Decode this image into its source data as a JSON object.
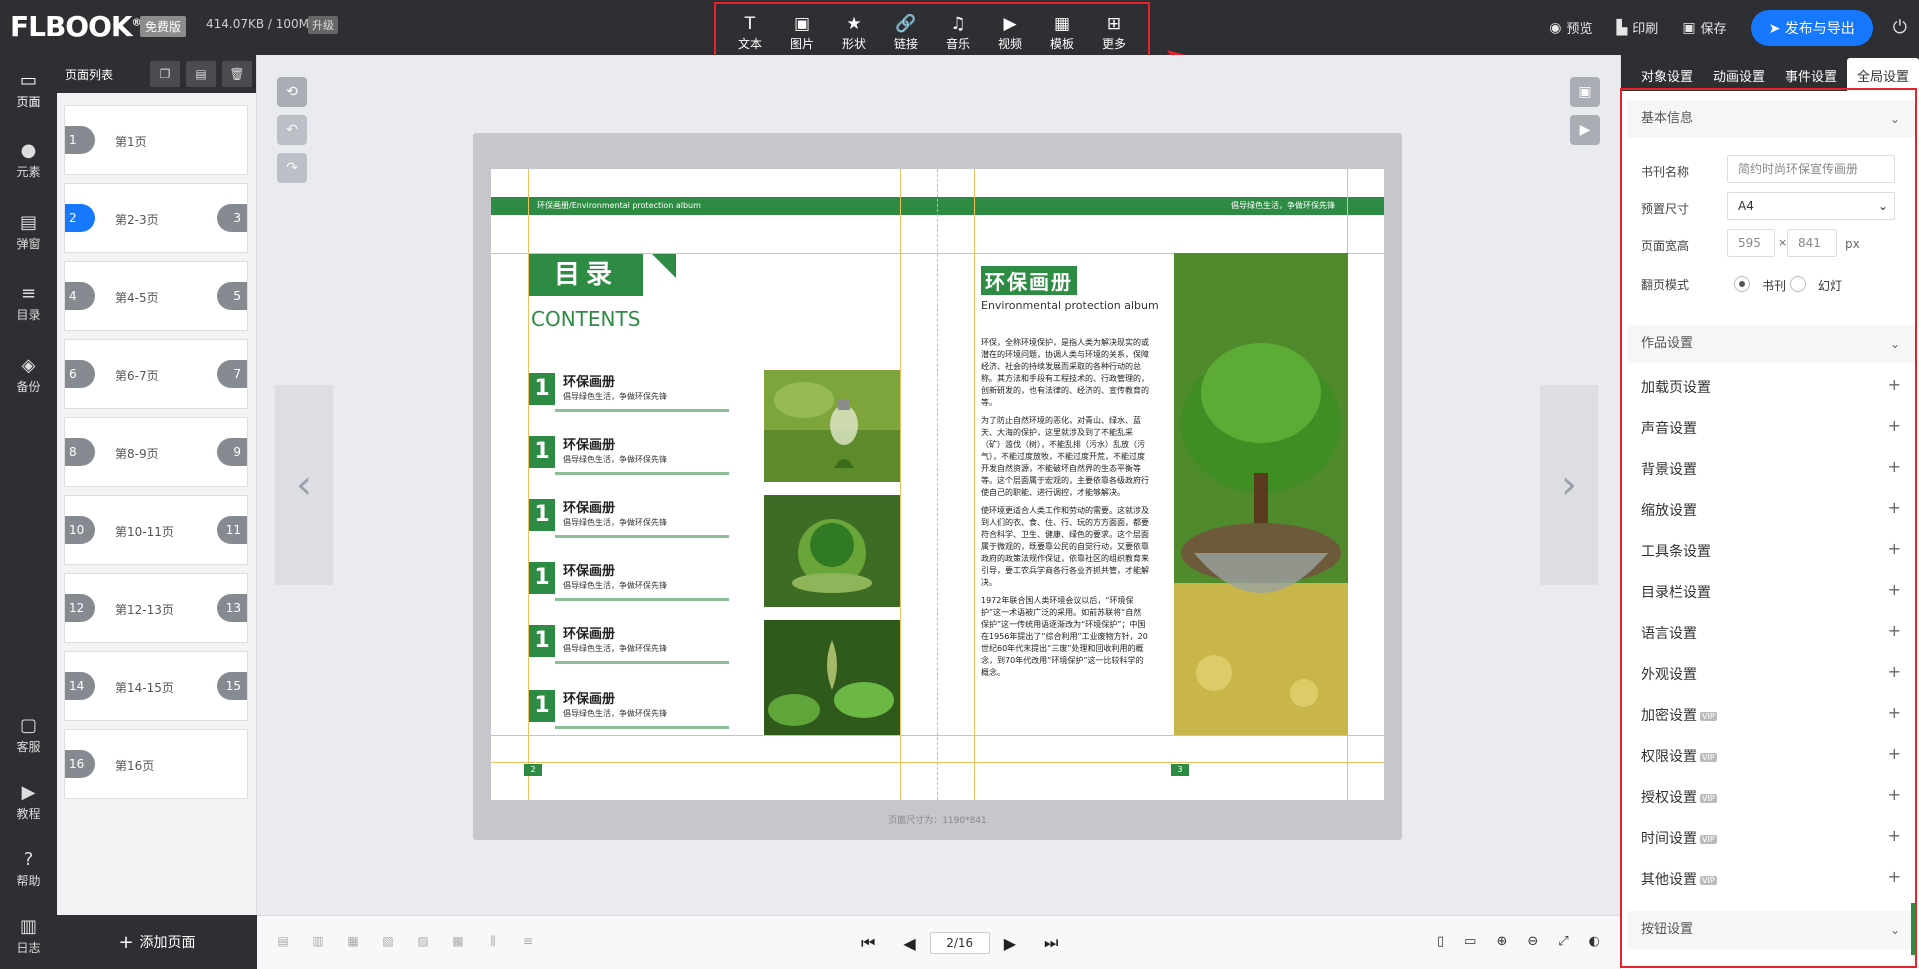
{
  "header": {
    "logo": "FLBOOK",
    "logo_mark": "®",
    "plan_badge": "免费版",
    "storage": "414.07KB / 100M",
    "upgrade": "升级",
    "tools": [
      {
        "label": "文本",
        "icon": "T"
      },
      {
        "label": "图片",
        "icon": "▣"
      },
      {
        "label": "形状",
        "icon": "★"
      },
      {
        "label": "链接",
        "icon": "🔗"
      },
      {
        "label": "音乐",
        "icon": "♫"
      },
      {
        "label": "视频",
        "icon": "▶"
      },
      {
        "label": "模板",
        "icon": "▦"
      },
      {
        "label": "更多",
        "icon": "⊞"
      }
    ],
    "preview": "预览",
    "print": "印刷",
    "save": "保存",
    "publish": "发布与导出"
  },
  "rail": [
    {
      "label": "页面",
      "icon": "▭"
    },
    {
      "label": "元素",
      "icon": "●"
    },
    {
      "label": "弹窗",
      "icon": "▤"
    },
    {
      "label": "目录",
      "icon": "≡"
    },
    {
      "label": "备份",
      "icon": "◈"
    },
    {
      "label": "客服",
      "icon": "▢"
    },
    {
      "label": "教程",
      "icon": "▶"
    },
    {
      "label": "帮助",
      "icon": "?"
    },
    {
      "label": "日志",
      "icon": "▥"
    }
  ],
  "pagelist": {
    "title": "页面列表",
    "add_page": "添加页面",
    "pages": [
      {
        "left": "1",
        "label": "第1页",
        "right": ""
      },
      {
        "left": "2",
        "label": "第2-3页",
        "right": "3"
      },
      {
        "left": "4",
        "label": "第4-5页",
        "right": "5"
      },
      {
        "left": "6",
        "label": "第6-7页",
        "right": "7"
      },
      {
        "left": "8",
        "label": "第8-9页",
        "right": "9"
      },
      {
        "left": "10",
        "label": "第10-11页",
        "right": "11"
      },
      {
        "left": "12",
        "label": "第12-13页",
        "right": "13"
      },
      {
        "left": "14",
        "label": "第14-15页",
        "right": "15"
      },
      {
        "left": "16",
        "label": "第16页",
        "right": ""
      }
    ]
  },
  "book": {
    "band_left": "环保画册/Environmental protection album",
    "band_right": "倡导绿色生活，争做环保先锋",
    "mulu": "目录",
    "contents": "CONTENTS",
    "toc": [
      {
        "num": "1",
        "title": "环保画册",
        "sub": "倡导绿色生活，争做环保先锋"
      },
      {
        "num": "1",
        "title": "环保画册",
        "sub": "倡导绿色生活，争做环保先锋"
      },
      {
        "num": "1",
        "title": "环保画册",
        "sub": "倡导绿色生活，争做环保先锋"
      },
      {
        "num": "1",
        "title": "环保画册",
        "sub": "倡导绿色生活，争做环保先锋"
      },
      {
        "num": "1",
        "title": "环保画册",
        "sub": "倡导绿色生活，争做环保先锋"
      },
      {
        "num": "1",
        "title": "环保画册",
        "sub": "倡导绿色生活，争做环保先锋"
      }
    ],
    "hb_title": "环保画册",
    "hb_sub": "Environmental protection album",
    "paragraphs": [
      "环保，全称环境保护，是指人类为解决现实的或潜在的环境问题，协调人类与环境的关系，保障经济、社会的持续发展而采取的各种行动的总称。其方法和手段有工程技术的、行政管理的，创新研发的，也有法律的、经济的、宣传教育的等。",
      "为了防止自然环境的恶化，对青山、绿水、蓝天、大海的保护，这里就涉及到了不能乱采（矿）滥伐（树），不能乱排（污水）乱放（污气），不能过度放牧，不能过度开荒，不能过度开发自然资源，不能破坏自然界的生态平衡等等。这个层面属于宏观的，主要依靠各级政府行使自己的职能、进行调控，才能够解决。",
      "使环境更适合人类工作和劳动的需要。这就涉及到人们的衣、食、住、行、玩的方方面面，都要符合科学、卫生、健康、绿色的要求。这个层面属于微观的，既要靠公民的自觉行动，又要依靠政府的政策法规作保证，依靠社区的组织教育来引导，要工农兵学商各行各业齐抓共管，才能解决。",
      "1972年联合国人类环境会议以后，“环境保护”这一术语被广泛的采用。如前苏联将“自然保护”这一传统用语逐渐改为“环境保护”；中国在1956年提出了“综合利用”工业废物方针，20世纪60年代末提出“三废”处理和回收利用的概念，到70年代改用“环境保护”这一比较科学的概念。"
    ],
    "page_left": "2",
    "page_right": "3",
    "size_note": "页面尺寸为：1190*841"
  },
  "pager": {
    "current": "2/16"
  },
  "panel": {
    "tabs": [
      "对象设置",
      "动画设置",
      "事件设置",
      "全局设置"
    ],
    "basic": "基本信息",
    "book_name_label": "书刊名称",
    "book_name": "简约时尚环保宣传画册",
    "preset_label": "预置尺寸",
    "preset": "A4",
    "wh_label": "页面宽高",
    "width": "595",
    "times": "×",
    "height": "841",
    "unit": "px",
    "flip_label": "翻页模式",
    "flip_book": "书刊",
    "flip_slide": "幻灯",
    "work": "作品设置",
    "settings": [
      {
        "label": "加载页设置",
        "vip": ""
      },
      {
        "label": "声音设置",
        "vip": ""
      },
      {
        "label": "背景设置",
        "vip": ""
      },
      {
        "label": "缩放设置",
        "vip": ""
      },
      {
        "label": "工具条设置",
        "vip": ""
      },
      {
        "label": "目录栏设置",
        "vip": ""
      },
      {
        "label": "语言设置",
        "vip": ""
      },
      {
        "label": "外观设置",
        "vip": ""
      },
      {
        "label": "加密设置",
        "vip": "VIP"
      },
      {
        "label": "权限设置",
        "vip": "VIP"
      },
      {
        "label": "授权设置",
        "vip": "VIP"
      },
      {
        "label": "时间设置",
        "vip": "VIP"
      },
      {
        "label": "其他设置",
        "vip": "VIP"
      }
    ],
    "button": "按钮设置"
  }
}
